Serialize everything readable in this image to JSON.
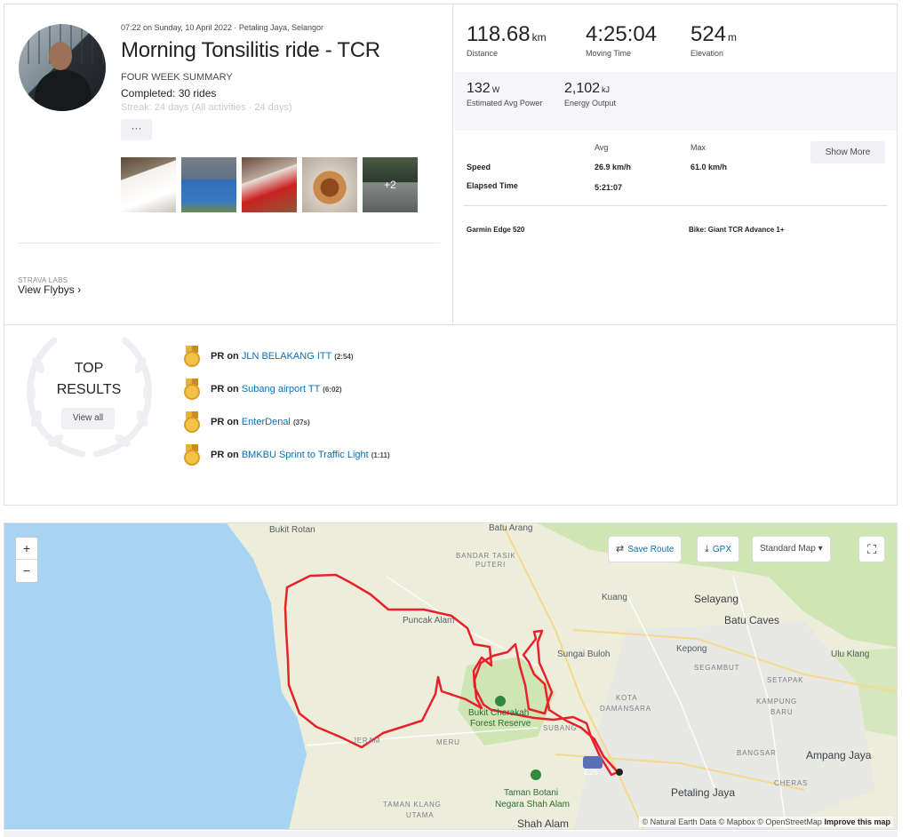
{
  "activity": {
    "meta": "07:22 on Sunday, 10 April 2022 · Petaling Jaya, Selangor",
    "title": "Morning Tonsilitis ride - TCR",
    "summary_heading": "FOUR WEEK SUMMARY",
    "completed": "Completed: 30 rides",
    "streak": "Streak: 24 days (All activities · 24 days)",
    "more_label": "···",
    "photos": [
      "drink-photo",
      "cyclist-photo",
      "bottle-photo",
      "food-photo",
      "road-photo"
    ],
    "photos_more_label": "+2",
    "labs_label": "STRAVA LABS",
    "flybys_label": "View Flybys",
    "flybys_chevron": "›"
  },
  "stats": {
    "primary": [
      {
        "value": "118.68",
        "unit": "km",
        "label": "Distance"
      },
      {
        "value": "4:25:04",
        "unit": "",
        "label": "Moving Time"
      },
      {
        "value": "524",
        "unit": "m",
        "label": "Elevation"
      }
    ],
    "secondary": [
      {
        "value": "132",
        "unit": "W",
        "label": "Estimated Avg Power"
      },
      {
        "value": "2,102",
        "unit": "kJ",
        "label": "Energy Output"
      }
    ],
    "table": {
      "avg_header": "Avg",
      "max_header": "Max",
      "rows": [
        {
          "label": "Speed",
          "avg": "26.9 km/h",
          "max": "61.0 km/h"
        },
        {
          "label": "Elapsed Time",
          "avg": "5:21:07",
          "max": ""
        }
      ]
    },
    "show_more": "Show More",
    "device": "Garmin Edge 520",
    "bike": "Bike: Giant TCR Advance 1+"
  },
  "top_results": {
    "title_line1": "TOP",
    "title_line2": "RESULTS",
    "view_all": "View all",
    "items": [
      {
        "prefix": "PR on",
        "segment": "JLN BELAKANG ITT",
        "time": "(2:54)"
      },
      {
        "prefix": "PR on",
        "segment": "Subang airport TT",
        "time": "(6:02)"
      },
      {
        "prefix": "PR on",
        "segment": "EnterDenal",
        "time": "(37s)"
      },
      {
        "prefix": "PR on",
        "segment": "BMKBU Sprint to Traffic Light",
        "time": "(1:11)"
      }
    ]
  },
  "map": {
    "zoom_in": "+",
    "zoom_out": "−",
    "save_route": "Save Route",
    "gpx": "GPX",
    "map_style": "Standard Map",
    "map_style_caret": "▾",
    "fullscreen_icon": "⛶",
    "attribution_prefix": "© Natural Earth Data © Mapbox © OpenStreetMap",
    "attribution_link": "Improve this map",
    "labels": {
      "bukit_rotan": "Bukit Rotan",
      "batu_arang": "Batu Arang",
      "bandar_tasik": "BANDAR TASIK",
      "puteri": "PUTERI",
      "kuang": "Kuang",
      "selayang": "Selayang",
      "batu_caves": "Batu Caves",
      "puncak_alam": "Puncak Alam",
      "sungai_buloh": "Sungai Buloh",
      "kepong": "Kepong",
      "ulu_klang": "Ulu Klang",
      "segambut": "SEGAMBUT",
      "setapak": "SETAPAK",
      "kota": "KOTA",
      "damansara": "DAMANSARA",
      "kampung": "KAMPUNG",
      "baru": "BARU",
      "bukit_cherakah": "Bukit Cherakah",
      "forest_reserve": "Forest Reserve",
      "subang": "SUBANG",
      "jeram": "JERAM",
      "meru": "MERU",
      "bangsar": "BANGSAR",
      "ampang_jaya": "Ampang Jaya",
      "cheras": "CHERAS",
      "highway_shield": "E26",
      "taman_botani": "Taman Botani",
      "negara": "Negara Shah Alam",
      "taman_klang": "TAMAN KLANG",
      "utama": "UTAMA",
      "petaling_jaya": "Petaling Jaya",
      "shah_alam": "Shah Alam"
    }
  },
  "colors": {
    "route": "#e8222b",
    "link": "#0a70b8",
    "sea": "#a6d4f2",
    "land": "#eceedb",
    "green": "#cfe5b4"
  }
}
